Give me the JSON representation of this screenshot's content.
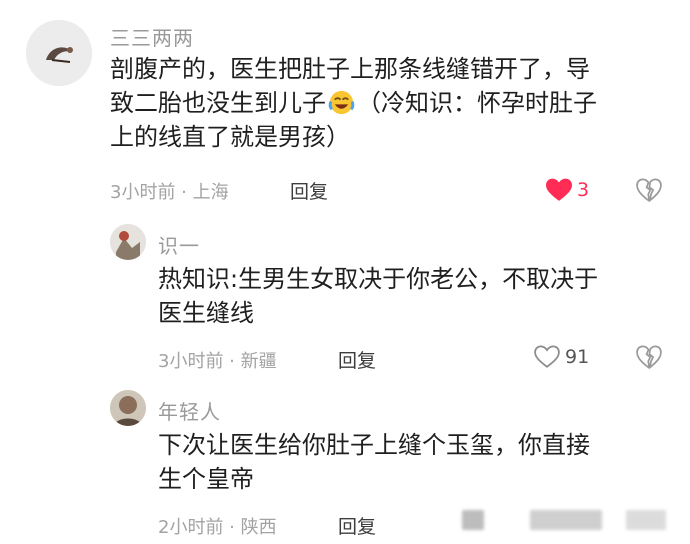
{
  "comments": [
    {
      "username": "三三两两",
      "lines": [
        "剖腹产的，医生把肚子上那条线缝错开了，导",
        "致二胎也没生到儿子",
        "（冷知识：怀孕时肚子",
        "上的线直了就是男孩）"
      ],
      "emoji": "laughing-crying-emoji",
      "meta": "3小时前 · 上海",
      "reply_label": "回复",
      "likes": "3",
      "liked": true
    },
    {
      "username": "识一",
      "lines": [
        "热知识:生男生女取决于你老公，不取决于",
        "医生缝线"
      ],
      "meta": "3小时前 · 新疆",
      "reply_label": "回复",
      "likes": "91",
      "liked": false
    },
    {
      "username": "年轻人",
      "lines": [
        "下次让医生给你肚子上缝个玉玺，你直接",
        "生个皇帝"
      ],
      "meta": "2小时前 · 陕西",
      "reply_label": "回复"
    }
  ],
  "colors": {
    "like_red": "#ff2c55",
    "meta_gray": "#a3a3a3",
    "name_gray": "#9a9a9a"
  },
  "icons": [
    "heart-filled-icon",
    "heart-outline-icon",
    "broken-heart-icon"
  ]
}
